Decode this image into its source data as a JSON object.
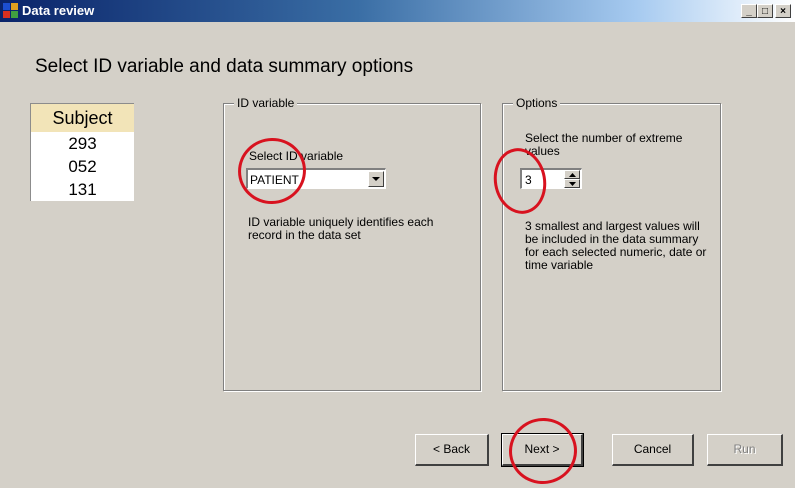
{
  "window": {
    "title": "Data review",
    "min_glyph": "_",
    "max_glyph": "□",
    "close_glyph": "×"
  },
  "heading": "Select ID variable and data summary options",
  "sample_table": {
    "header": "Subject",
    "rows": [
      "293",
      "052",
      "131"
    ]
  },
  "id_group": {
    "legend": "ID variable",
    "select_label": "Select ID variable",
    "selected_value": "PATIENT",
    "description": "ID variable uniquely identifies each record in the data set"
  },
  "options_group": {
    "legend": "Options",
    "prompt": "Select the number of extreme values",
    "extreme_count": "3",
    "description": "3 smallest and largest values will be included in the data summary for each selected numeric, date or time variable"
  },
  "buttons": {
    "back": "< Back",
    "next": "Next >",
    "cancel": "Cancel",
    "run": "Run"
  },
  "colors": {
    "annotation": "#d8121f",
    "table_header": "#f2e4b8",
    "titlebar": "#0a246a"
  }
}
